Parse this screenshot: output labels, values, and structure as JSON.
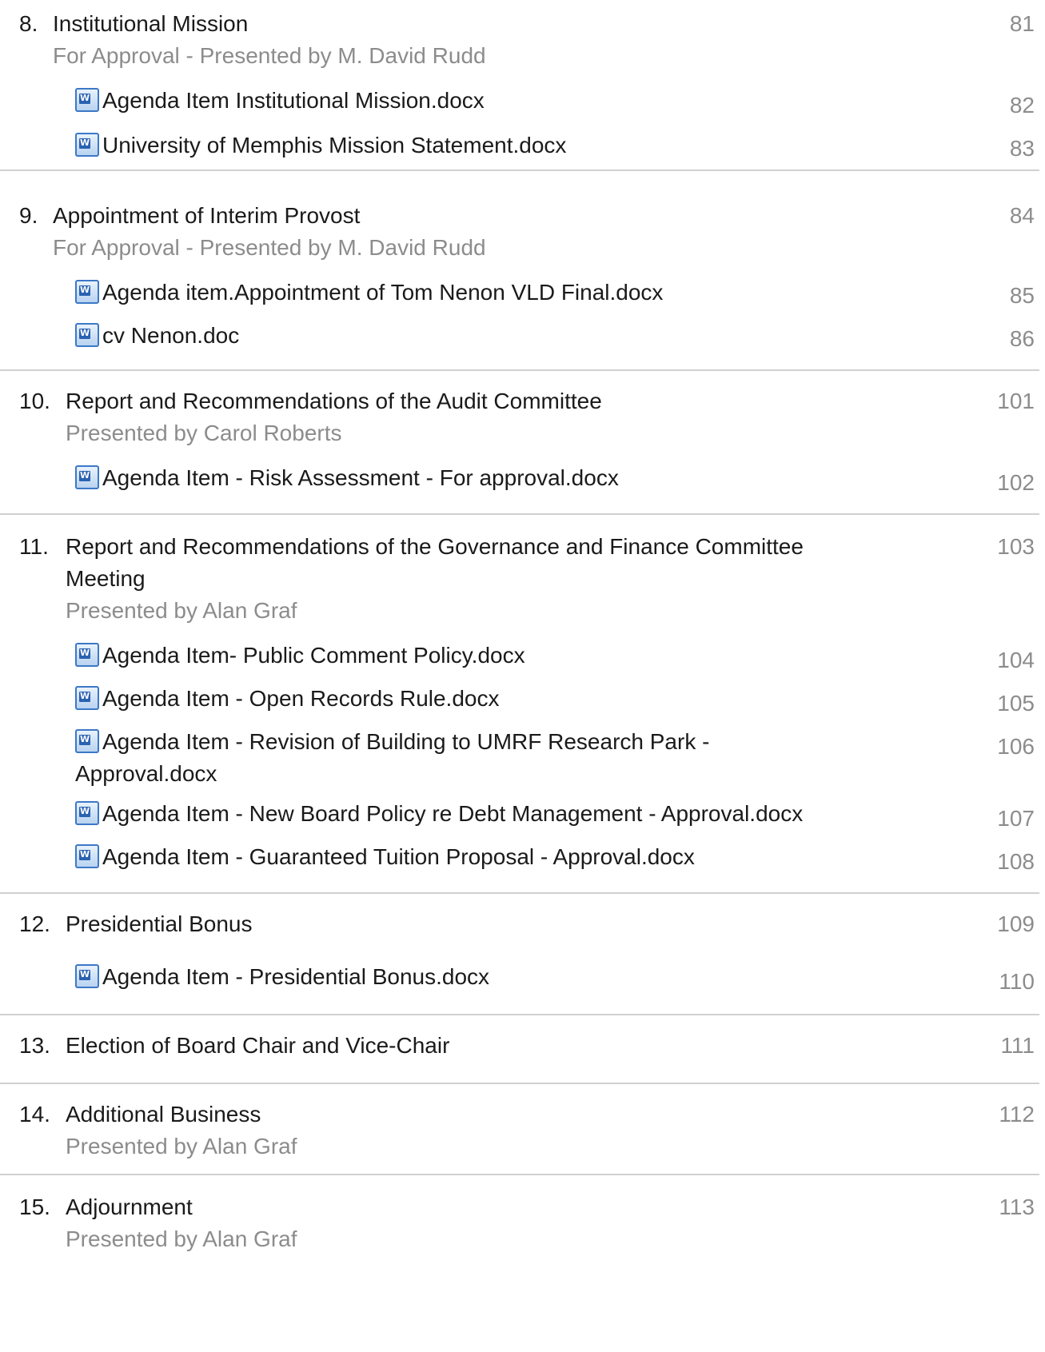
{
  "items": [
    {
      "number": "8.",
      "title": "Institutional Mission",
      "presenter": "For Approval - Presented by M. David Rudd",
      "page": "81",
      "documents": [
        {
          "name": "Agenda Item Institutional Mission.docx",
          "page": "82"
        },
        {
          "name": "University of Memphis Mission Statement.docx",
          "page": "83"
        }
      ]
    },
    {
      "number": "9.",
      "title": "Appointment of Interim Provost",
      "presenter": "For Approval - Presented by M. David Rudd",
      "page": "84",
      "documents": [
        {
          "name": "Agenda item.Appointment of Tom Nenon VLD Final.docx",
          "page": "85"
        },
        {
          "name": "cv Nenon.doc",
          "page": "86"
        }
      ]
    },
    {
      "number": "10.",
      "title": "Report and Recommendations of the Audit Committee",
      "presenter": "Presented by Carol Roberts",
      "page": "101",
      "documents": [
        {
          "name": "Agenda Item - Risk Assessment - For approval.docx",
          "page": "102"
        }
      ]
    },
    {
      "number": "11.",
      "title": "Report and Recommendations of the Governance and Finance Committee Meeting",
      "presenter": "Presented by Alan Graf",
      "page": "103",
      "documents": [
        {
          "name": "Agenda Item- Public Comment Policy.docx",
          "page": "104"
        },
        {
          "name": "Agenda Item - Open Records Rule.docx",
          "page": "105"
        },
        {
          "name": "Agenda Item - Revision of Building to UMRF Research Park - Approval.docx",
          "page": "106"
        },
        {
          "name": "Agenda Item - New Board Policy re Debt Management - Approval.docx",
          "page": "107"
        },
        {
          "name": "Agenda Item - Guaranteed Tuition Proposal - Approval.docx",
          "page": "108"
        }
      ]
    },
    {
      "number": "12.",
      "title": "Presidential Bonus",
      "presenter": "",
      "page": "109",
      "documents": [
        {
          "name": "Agenda Item - Presidential Bonus.docx",
          "page": "110"
        }
      ]
    },
    {
      "number": "13.",
      "title": "Election of Board Chair and Vice-Chair",
      "presenter": "",
      "page": "111",
      "documents": []
    },
    {
      "number": "14.",
      "title": "Additional Business",
      "presenter": "Presented by Alan Graf",
      "page": "112",
      "documents": []
    },
    {
      "number": "15.",
      "title": "Adjournment",
      "presenter": "Presented by Alan Graf",
      "page": "113",
      "documents": []
    }
  ]
}
